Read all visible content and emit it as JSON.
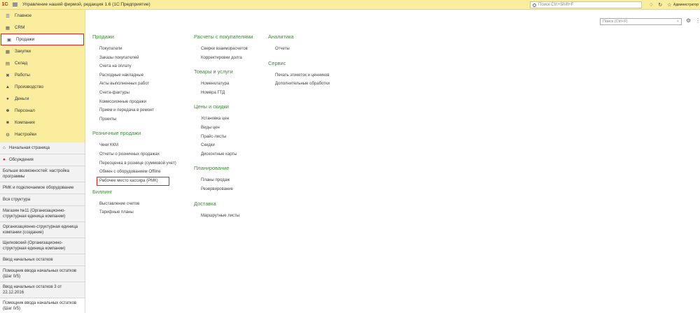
{
  "titlebar": {
    "logo": "1С",
    "title": "Управление нашей фирмой, редакция 1.6  (1С:Предприятие)",
    "search_placeholder": "Поиск Ctrl+Shift+F",
    "user": "Администратор"
  },
  "sidebar": {
    "sections": [
      {
        "label": "Главное",
        "icon": "hamburger-icon"
      },
      {
        "label": "CRM",
        "icon": "crm-icon"
      },
      {
        "label": "Продажи",
        "icon": "cart-icon"
      },
      {
        "label": "Закупки",
        "icon": "basket-icon"
      },
      {
        "label": "Склад",
        "icon": "warehouse-icon"
      },
      {
        "label": "Работы",
        "icon": "tools-icon"
      },
      {
        "label": "Производство",
        "icon": "factory-icon"
      },
      {
        "label": "Деньги",
        "icon": "money-icon"
      },
      {
        "label": "Персонал",
        "icon": "person-icon"
      },
      {
        "label": "Компания",
        "icon": "company-icon"
      },
      {
        "label": "Настройки",
        "icon": "gear-icon"
      }
    ],
    "open_windows": [
      {
        "label": "Начальная страница",
        "icon": "home-icon"
      },
      {
        "label": "Обсуждения",
        "icon": "discussion-icon"
      },
      {
        "label": "Больше возможностей: настройка программы"
      },
      {
        "label": "РМК и подключаемое оборудование"
      },
      {
        "label": "Вся структура"
      },
      {
        "label": "Магазин №11 (Организационно-структурная единица компании)"
      },
      {
        "label": "Организационно-структурная единица компании (создание)"
      },
      {
        "label": "Щелковский (Организационно-структурная единица компании)"
      },
      {
        "label": "Ввод начальных остатков"
      },
      {
        "label": "Помощник ввода начальных остатков (Шаг 0/5)"
      },
      {
        "label": "Ввод начальных остатков 3 от 22.12.2016"
      },
      {
        "label": "Помощник ввода начальных остатков (Шаг 0/5)"
      }
    ]
  },
  "content": {
    "search_placeholder": "Поиск (Ctrl+F)",
    "clear_symbol": "×",
    "columns": [
      [
        {
          "title": "Продажи",
          "links": [
            "Покупатели",
            "Заказы покупателей",
            "Счета на оплату",
            "Расходные накладные",
            "Акты выполненных работ",
            "Счета-фактуры",
            "Комиссионные продажи",
            "Прием и передача в ремонт",
            "Проекты"
          ]
        },
        {
          "title": "Розничные продажи",
          "links": [
            "Чеки ККМ",
            "Отчеты о розничных продажах",
            "Переоценка в рознице (суммовой учет)",
            "Обмен с оборудованием Offline",
            "Рабочее место кассира (РМК)"
          ]
        },
        {
          "title": "Биллинг",
          "links": [
            "Выставление счетов",
            "Тарифные планы"
          ]
        }
      ],
      [
        {
          "title": "Расчеты с покупателями",
          "links": [
            "Сверки взаиморасчетов",
            "Корректировки долга"
          ]
        },
        {
          "title": "Товары и услуги",
          "links": [
            "Номенклатура",
            "Номера ГТД"
          ]
        },
        {
          "title": "Цены и скидки",
          "links": [
            "Установка цен",
            "Виды цен",
            "Прайс-листы",
            "Скидки",
            "Дисконтные карты"
          ]
        },
        {
          "title": "Планирование",
          "links": [
            "Планы продаж",
            "Резервирование"
          ]
        },
        {
          "title": "Доставка",
          "links": [
            "Маршрутные листы"
          ]
        }
      ],
      [
        {
          "title": "Аналитика",
          "links": [
            "Отчеты"
          ]
        },
        {
          "title": "Сервис",
          "links": [
            "Печать этикеток и ценников",
            "Дополнительные обработки"
          ]
        }
      ]
    ]
  }
}
